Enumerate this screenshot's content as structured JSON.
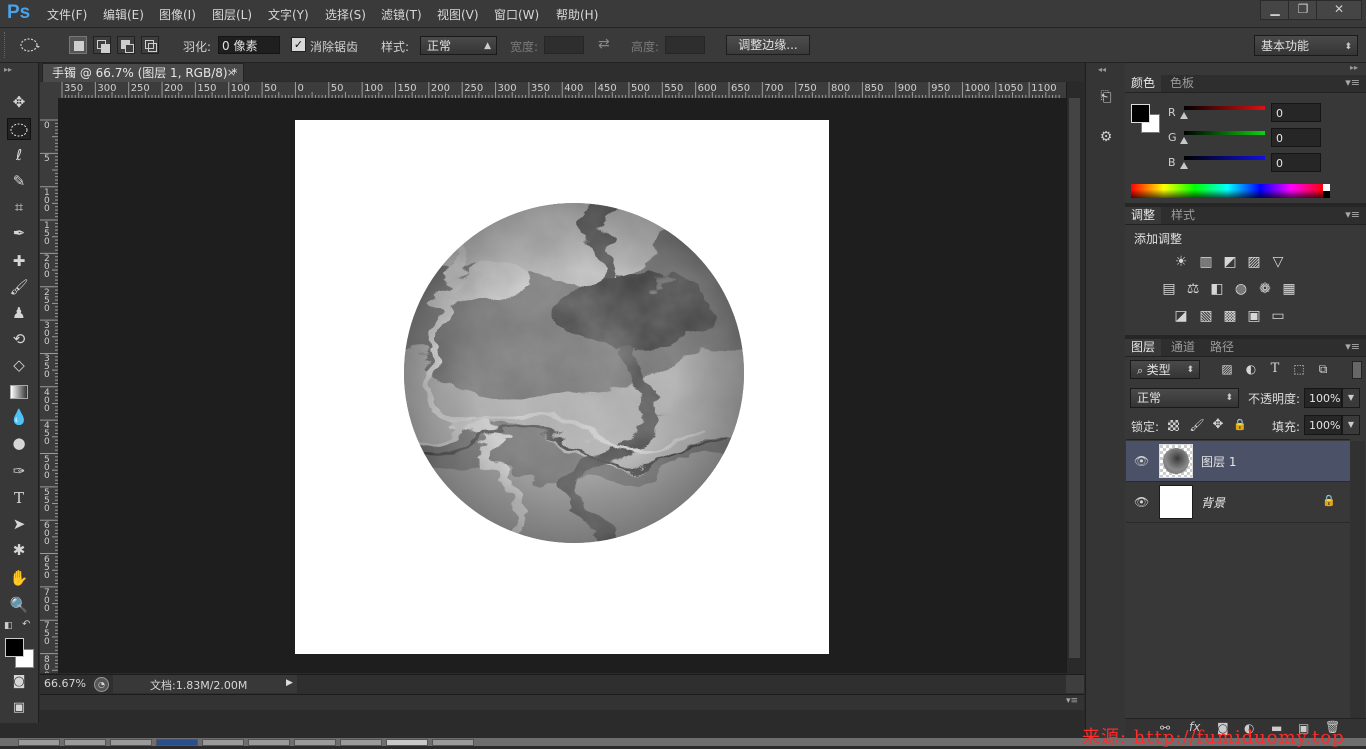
{
  "app": {
    "logo": "Ps"
  },
  "menu": [
    "文件(F)",
    "编辑(E)",
    "图像(I)",
    "图层(L)",
    "文字(Y)",
    "选择(S)",
    "滤镜(T)",
    "视图(V)",
    "窗口(W)",
    "帮助(H)"
  ],
  "window_controls": {
    "minimize": "▁",
    "restore": "❐",
    "close": "✕"
  },
  "options": {
    "feather_label": "羽化:",
    "feather_value": "0 像素",
    "antialias_checkmark": "✓",
    "antialias_label": "消除锯齿",
    "style_label": "样式:",
    "style_value": "正常",
    "width_label": "宽度:",
    "height_label": "高度:",
    "refine_edge_button": "调整边缘...",
    "workspace_value": "基本功能"
  },
  "document": {
    "tab_title": "手镯 @ 66.7% (图层 1, RGB/8) *",
    "tab_close": "×",
    "background_color": "#ffffff"
  },
  "ruler": {
    "h_labels": [
      "350",
      "300",
      "250",
      "200",
      "150",
      "100",
      "50",
      "0",
      "50",
      "100",
      "150",
      "200",
      "250",
      "300",
      "350",
      "400",
      "450",
      "500",
      "550",
      "600",
      "650",
      "700",
      "750",
      "800",
      "850",
      "900",
      "950",
      "1000",
      "1050",
      "1100"
    ],
    "v_labels": [
      "0",
      "5",
      "1 0 0",
      "1 5 0",
      "2 0 0",
      "2 5 0",
      "3 0 0",
      "3 5 0",
      "4 0 0",
      "4 5 0",
      "5 0 0",
      "5 5 0",
      "6 0 0",
      "6 5 0",
      "7 0 0",
      "7 5 0",
      "8 0 0",
      "8 5 0"
    ]
  },
  "status": {
    "zoom": "66.67%",
    "doc_info": "文档:1.83M/2.00M",
    "expand_arrow": "▶"
  },
  "panels": {
    "color": {
      "tabs": [
        "颜色",
        "色板"
      ],
      "channels": [
        {
          "label": "R",
          "value": "0",
          "color": "#d01818"
        },
        {
          "label": "G",
          "value": "0",
          "color": "#18c018"
        },
        {
          "label": "B",
          "value": "0",
          "color": "#1818d8"
        }
      ],
      "foreground": "#000000",
      "background": "#ffffff"
    },
    "adjustments": {
      "tabs": [
        "调整",
        "样式"
      ],
      "title": "添加调整",
      "rows": [
        [
          "☀",
          "▥",
          "◩",
          "▨",
          "▽"
        ],
        [
          "▤",
          "⚖",
          "◧",
          "◍",
          "❁",
          "▦"
        ],
        [
          "◪",
          "▧",
          "▩",
          "▣",
          "▭"
        ]
      ]
    },
    "layers": {
      "tabs": [
        "图层",
        "通道",
        "路径"
      ],
      "filter_label": "类型",
      "blend_mode": "正常",
      "opacity_label": "不透明度:",
      "opacity_value": "100%",
      "lock_label": "锁定:",
      "fill_label": "填充:",
      "fill_value": "100%",
      "items": [
        {
          "name": "图层 1",
          "selected": true
        },
        {
          "name": "背景",
          "selected": false,
          "locked": true
        }
      ],
      "footer_icons": [
        "⚯",
        "fx",
        "◙",
        "◐",
        "▬",
        "▣",
        "🗑"
      ]
    }
  },
  "watermark": "来源: http://fumiduomy.top"
}
